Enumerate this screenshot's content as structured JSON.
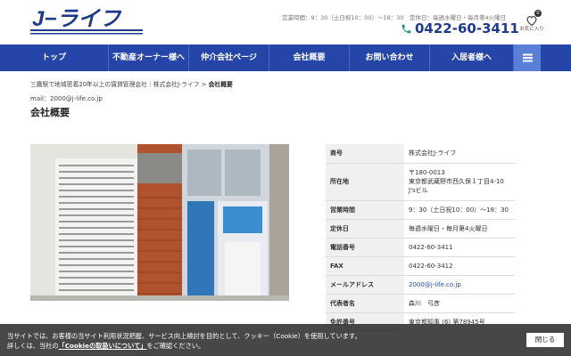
{
  "header": {
    "logo_text": "J−ライフ",
    "hours": "営業時間：9：30（土日祝10：00）〜18：30　定休日：毎週水曜日・毎月第4火曜日",
    "phone": "0422-60-3411",
    "favorites_count": "0",
    "favorites_label": "お気に入り",
    "accent": "#2546a8"
  },
  "nav": {
    "items": [
      {
        "label": "トップ"
      },
      {
        "label": "不動産オーナー様へ"
      },
      {
        "label": "仲介会社ページ"
      },
      {
        "label": "会社概要"
      },
      {
        "label": "お問い合わせ"
      },
      {
        "label": "入居者様へ"
      }
    ],
    "menu_icon": "hamburger-icon"
  },
  "breadcrumb": {
    "home": "三鷹駅で地域密着20年以上の賃貸管理会社｜株式会社J-ライフ",
    "separator": ">",
    "current": "会社概要"
  },
  "page": {
    "mail": "mail：2000@j-life.co.jp",
    "title": "会社概要"
  },
  "company_table": [
    {
      "key": "商号",
      "value": "株式会社J-ライフ"
    },
    {
      "key": "所在地",
      "value": "〒180-0013\n東京都武蔵野市西久保１丁目4-10\nJ'sビル"
    },
    {
      "key": "営業時間",
      "value": "9：30（土日祝10：00）〜18：30"
    },
    {
      "key": "定休日",
      "value": "毎週水曜日・毎月第4火曜日"
    },
    {
      "key": "電話番号",
      "value": "0422-60-3411"
    },
    {
      "key": "FAX",
      "value": "0422-60-3412"
    },
    {
      "key": "メールアドレス",
      "value": "2000@j-life.co.jp"
    },
    {
      "key": "代表者名",
      "value": "森川　弓彦"
    },
    {
      "key": "免許番号",
      "value": "東京都知事 (6) 第78945号"
    }
  ],
  "cookie": {
    "line1": "当サイトでは、お客様の当サイト利用状況把握、サービス向上検討を目的として、クッキー（Cookie）を使用しています。",
    "line2_pre": "詳しくは、当社の",
    "line2_link": "「Cookieの取扱いについて」",
    "line2_post": "をご確認ください。",
    "close_label": "閉じる"
  }
}
